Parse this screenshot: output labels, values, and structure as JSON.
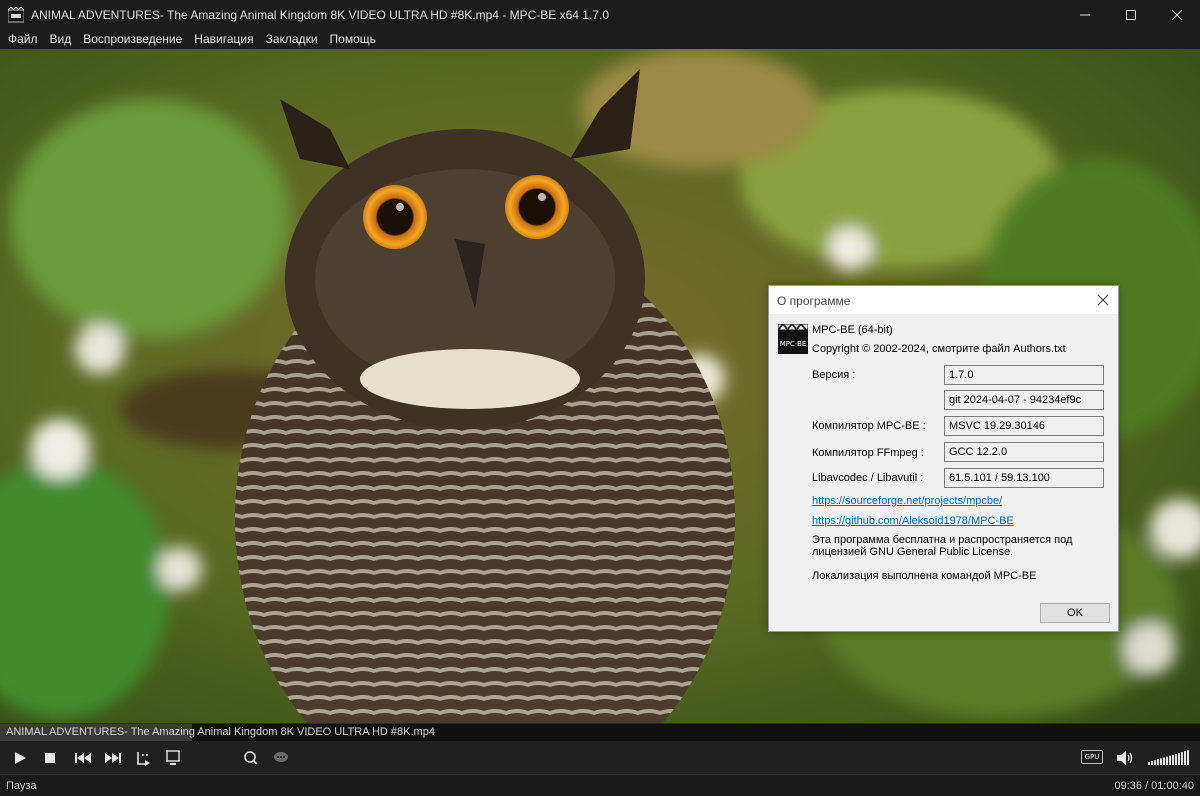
{
  "window": {
    "title": "ANIMAL ADVENTURES- The Amazing Animal Kingdom 8K VIDEO ULTRA HD #8K.mp4 - MPC-BE x64 1.7.0"
  },
  "menu": [
    {
      "label": "Файл"
    },
    {
      "label": "Вид"
    },
    {
      "label": "Воспроизведение"
    },
    {
      "label": "Навигация"
    },
    {
      "label": "Закладки"
    },
    {
      "label": "Помощь"
    }
  ],
  "player": {
    "file_name": "ANIMAL ADVENTURES- The Amazing Animal Kingdom 8K VIDEO ULTRA HD #8K.mp4",
    "progress_fraction": 0.16,
    "gpu_label": "GPU",
    "status": "Пауза",
    "time": "09:36 / 01:00:40",
    "volume_fraction": 1.0,
    "controls": [
      "play-icon",
      "stop-icon",
      "previous-icon",
      "next-icon",
      "frame-step-icon",
      "subtitles-icon",
      "search-icon",
      "chat-icon",
      "volume-icon"
    ]
  },
  "dialog": {
    "title": "О программе",
    "product": "MPC-BE (64-bit)",
    "copyright": "Copyright © 2002-2024, смотрите файл Authors.txt",
    "version_label": "Версия :",
    "version": "1.7.0",
    "git": "git 2024-04-07 - 94234ef9c",
    "compiler_label": "Компилятор MPC-BE :",
    "compiler": "MSVC 19.29.30146",
    "ffmpeg_label": "Компилятор FFmpeg :",
    "ffmpeg": "GCC 12.2.0",
    "libs_label": "Libavcodec / Libavutil :",
    "libs": "61.5.101 / 59.13.100",
    "link1": "https://sourceforge.net/projects/mpcbe/",
    "link2": "https://github.com/Aleksoid1978/MPC-BE",
    "license_line1": "Эта программа бесплатна и распространяется под",
    "license_line2": "лицензией GNU General Public License.",
    "localization": "Локализация выполнена командой MPC-BE",
    "ok": "OK",
    "logo_text": "MPC·BE"
  },
  "colors": {
    "chrome": "#1c1c1c",
    "dialog_bg": "#f0f0f0",
    "link": "#0066cc",
    "owl_eye": "#f0a020"
  }
}
